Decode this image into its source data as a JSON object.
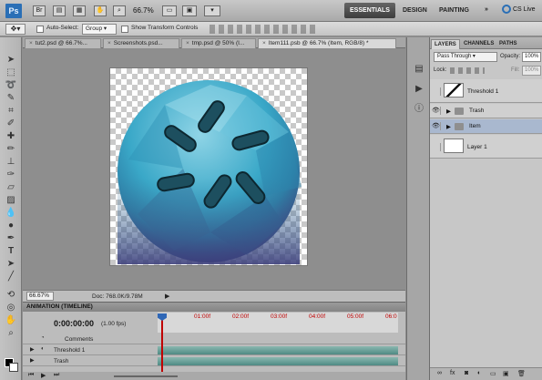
{
  "appbar": {
    "logo": "Ps",
    "icon_br": "Br",
    "zoom": "66.7%",
    "workspaces": [
      "ESSENTIALS",
      "DESIGN",
      "PAINTING"
    ],
    "active_workspace": "ESSENTIALS",
    "cs_live": "CS Live"
  },
  "options": {
    "auto_select_label": "Auto-Select:",
    "auto_select_value": "Group",
    "show_transform_label": "Show Transform Controls"
  },
  "doc_tabs": [
    {
      "label": "tut2.psd @ 66.7%..."
    },
    {
      "label": "Screenshots.psd..."
    },
    {
      "label": "tmp.psd @ 50% (I..."
    },
    {
      "label": "Item111.psb @ 66.7% (Item, RGB/8) *",
      "active": true
    }
  ],
  "status": {
    "zoom": "66.67%",
    "doc": "Doc: 768.0K/9.78M"
  },
  "animation": {
    "header": "ANIMATION (TIMELINE)",
    "timecode": "0:00:00:00",
    "fps": "(1.00 fps)",
    "ticks": [
      "01:00f",
      "02:00f",
      "03:00f",
      "04:00f",
      "05:00f",
      "06:0"
    ],
    "rows": [
      {
        "name": "Comments"
      },
      {
        "name": "Threshold 1"
      },
      {
        "name": "Trash"
      }
    ]
  },
  "layers_panel": {
    "tabs": [
      "LAYERS",
      "CHANNELS",
      "PATHS"
    ],
    "blend_mode": "Pass Through",
    "opacity_label": "Opacity:",
    "opacity_value": "100%",
    "lock_label": "Lock:",
    "fill_label": "Fill:",
    "fill_value": "100%",
    "layers": [
      {
        "name": "Threshold 1",
        "type": "adjustment",
        "visible": false
      },
      {
        "name": "Trash",
        "type": "group",
        "visible": true
      },
      {
        "name": "Item",
        "type": "group",
        "visible": true,
        "selected": true
      },
      {
        "name": "Layer 1",
        "type": "pixel",
        "visible": false
      }
    ]
  },
  "colors": {
    "accent_blue": "#2a6fb6",
    "timeline_track": "#5d9a92",
    "tick_red": "#c00000",
    "selected_layer": "#a9b8cf"
  }
}
